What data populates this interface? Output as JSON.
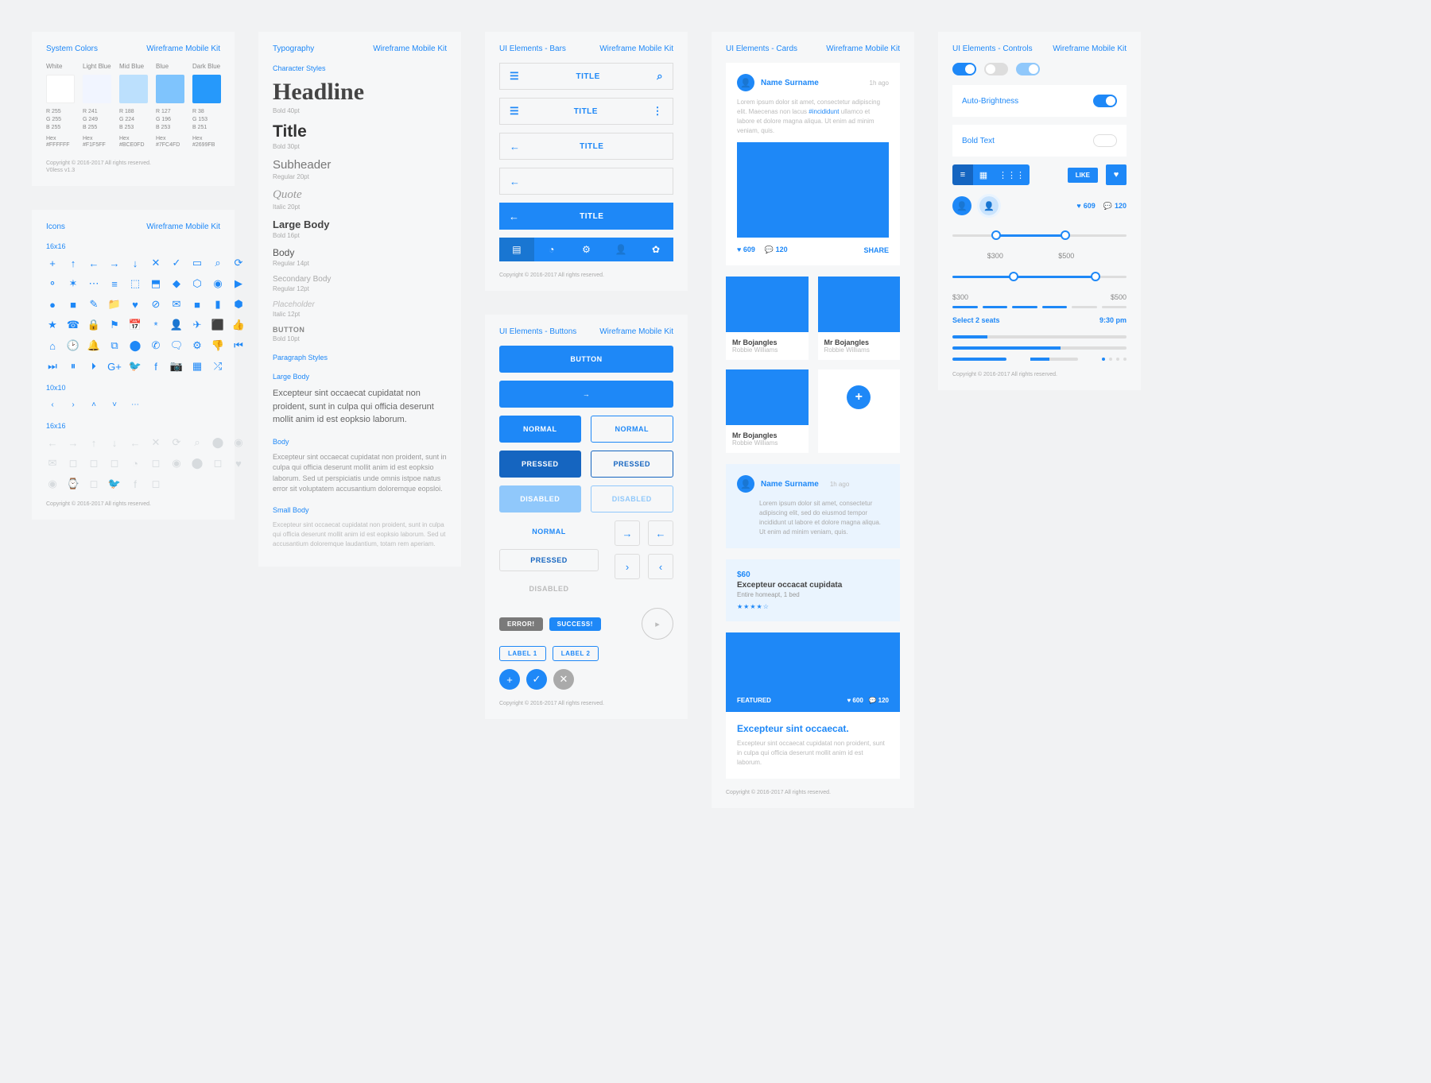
{
  "kit": "Wireframe Mobile Kit",
  "copyright": "Copyright © 2016-2017 All rights reserved.",
  "panels": {
    "colors": {
      "title": "System Colors",
      "swatches": [
        {
          "name": "White",
          "hex": "#FFFFFF",
          "r": "R 255",
          "g": "G 255",
          "b": "B 255"
        },
        {
          "name": "Light Blue",
          "hex": "#F1F5FF",
          "r": "R 241",
          "g": "G 249",
          "b": "B 255"
        },
        {
          "name": "Mid Blue",
          "hex": "#BCE0FD",
          "r": "R 188",
          "g": "G 224",
          "b": "B 253"
        },
        {
          "name": "Blue",
          "hex": "#7FC4FD",
          "r": "R 127",
          "g": "G 196",
          "b": "B 253"
        },
        {
          "name": "Dark Blue",
          "hex": "#2699FB",
          "r": "R 38",
          "g": "G 153",
          "b": "B 251"
        }
      ],
      "render": [
        "#FFFFFF",
        "#F1F5FF",
        "#BCE0FD",
        "#7FC4FD",
        "#2699FB"
      ],
      "hex_label": "Hex",
      "note": "V0less v1.3"
    },
    "icons": {
      "title": "Icons",
      "size16": "16x16",
      "size10": "10x10",
      "size16b": "16x16",
      "set": [
        "+",
        "↑",
        "←",
        "→",
        "↓",
        "✕",
        "✓",
        "▭",
        "⌕",
        "⟳",
        "⚬",
        "✶",
        "⋯",
        "≡",
        "⬚",
        "⬒",
        "◆",
        "⬡",
        "◉",
        "▶",
        "●",
        "■",
        "✎",
        "📁",
        "♥",
        "⊘",
        "✉",
        "■",
        "▮",
        "⬢",
        "★",
        "☎",
        "🔒",
        "⚑",
        "📅",
        "*",
        "👤",
        "✈",
        "⬛",
        "👍",
        "⌂",
        "🕑",
        "🔔",
        "⧉",
        "⬤",
        "✆",
        "🗨",
        "⚙",
        "👎",
        "⏮",
        "⏭",
        "⏸",
        "🞂",
        "G+",
        "🐦",
        "f",
        "📷",
        "▦",
        "⤮"
      ],
      "set10": [
        "‹",
        "›",
        "˄",
        "˅",
        "⋯"
      ],
      "setw": [
        "←",
        "→",
        "↑",
        "↓",
        "←",
        "✕",
        "⟳",
        "⌕",
        "⬤",
        "◉",
        "✉",
        "◻",
        "◻",
        "◻",
        "◔",
        "◻",
        "◉",
        "⬤",
        "◻",
        "♥",
        "◉",
        "⌚",
        "◻",
        "🐦",
        "f",
        "◻"
      ]
    },
    "typo": {
      "title": "Typography",
      "char_styles": "Character Styles",
      "para_styles": "Paragraph Styles",
      "entries": [
        {
          "label": "Headline",
          "cap": "Bold 40pt",
          "cls": "headline"
        },
        {
          "label": "Title",
          "cap": "Bold 30pt",
          "cls": "title"
        },
        {
          "label": "Subheader",
          "cap": "Regular 20pt",
          "cls": "subheader"
        },
        {
          "label": "Quote",
          "cap": "Italic 20pt",
          "cls": "quote"
        },
        {
          "label": "Large Body",
          "cap": "Bold 16pt",
          "cls": "lb"
        },
        {
          "label": "Body",
          "cap": "Regular 14pt",
          "cls": "bd"
        },
        {
          "label": "Secondary Body",
          "cap": "Regular 12pt",
          "cls": "sb"
        },
        {
          "label": "Placeholder",
          "cap": "Italic 12pt",
          "cls": "ph"
        },
        {
          "label": "BUTTON",
          "cap": "Bold 10pt",
          "cls": "btntxt"
        }
      ],
      "large_body": "Large Body",
      "body_lbl": "Body",
      "small_body": "Small Body",
      "para_large": "Excepteur sint occaecat cupidatat non proident, sunt in culpa qui officia deserunt mollit anim id est eopksio laborum.",
      "para_body": "Excepteur sint occaecat cupidatat non proident, sunt in culpa qui officia deserunt mollit anim id est eopksio laborum. Sed ut perspiciatis unde omnis istpoe natus error sit voluptatem accusantium doloremque eopsloi.",
      "para_small": "Excepteur sint occaecat cupidatat non proident, sunt in culpa qui officia deserunt mollit anim id est eopksio laborum. Sed ut accusantium doloremque laudantium, totam rem aperiam."
    },
    "bars": {
      "title": "UI Elements - Bars",
      "bar_title": "TITLE"
    },
    "buttons": {
      "title": "UI Elements - Buttons",
      "button": "BUTTON",
      "normal": "NORMAL",
      "pressed": "PRESSED",
      "disabled": "DISABLED",
      "error": "ERROR!",
      "success": "SUCCESS!",
      "label1": "LABEL 1",
      "label2": "LABEL 2"
    },
    "cards": {
      "title": "UI Elements - Cards",
      "user": "Name Surname",
      "ago": "1h ago",
      "lorem": "Lorem ipsum dolor sit amet, consectetur adipiscing elit. Maecenas non lacus #incididunt ullamco et labore et dolore magna aliqua. Ut enim ad minim veniam, quis.",
      "hash": "#incididunt",
      "likes": "609",
      "comments": "120",
      "share": "SHARE",
      "mr": "Mr Bojangles",
      "rob": "Robbie Williams",
      "comment_body": "Lorem ipsum dolor sit amet, consectetur adipiscing elit, sed do eiusmod tempor incididunt ut labore et dolore magna aliqua. Ut enim ad minim veniam, quis.",
      "price": "$60",
      "list_title": "Excepteur occacat cupidata",
      "list_sub": "Entire homeapt, 1 bed",
      "stars_txt": "★★★★☆",
      "featured": "FEATURED",
      "feat_likes": "600",
      "feat_cmt": "120",
      "feat_title": "Excepteur sint occaecat.",
      "feat_body": "Excepteur sint occaecat cupidatat non proident, sunt in culpa qui officia deserunt mollit anim id est laborum."
    },
    "controls": {
      "title": "UI Elements - Controls",
      "auto": "Auto-Brightness",
      "bold": "Bold Text",
      "like": "LIKE",
      "likes": "609",
      "comments": "120",
      "v300": "$300",
      "v500": "$500",
      "sel": "Select 2 seats",
      "time": "9:30 pm"
    }
  }
}
